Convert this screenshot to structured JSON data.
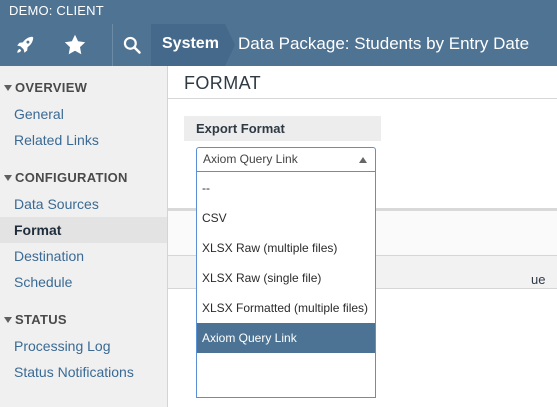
{
  "header": {
    "client_label": "DEMO: CLIENT",
    "breadcrumb_system": "System",
    "page_title": "Data Package: Students by Entry Date",
    "icons": [
      "rocket-icon",
      "star-icon",
      "search-icon"
    ]
  },
  "sidebar": {
    "sections": [
      {
        "title": "OVERVIEW",
        "items": [
          "General",
          "Related Links"
        ]
      },
      {
        "title": "CONFIGURATION",
        "items": [
          "Data Sources",
          "Format",
          "Destination",
          "Schedule"
        ]
      },
      {
        "title": "STATUS",
        "items": [
          "Processing Log",
          "Status Notifications"
        ]
      }
    ],
    "active_item": "Format"
  },
  "main": {
    "title": "FORMAT",
    "export_label": "Export Format",
    "selected_value": "Axiom Query Link",
    "options": [
      "--",
      "CSV",
      "XLSX Raw (multiple files)",
      "XLSX Raw (single file)",
      "XLSX Formatted (multiple files)",
      "Axiom Query Link"
    ],
    "column_header_fragment": "ue"
  },
  "colors": {
    "header_bg": "#4f7393",
    "crumb_bg": "#45698a",
    "link": "#3a6a94",
    "selected_option": "#4d7394",
    "focus_border": "#5b8fd6"
  }
}
